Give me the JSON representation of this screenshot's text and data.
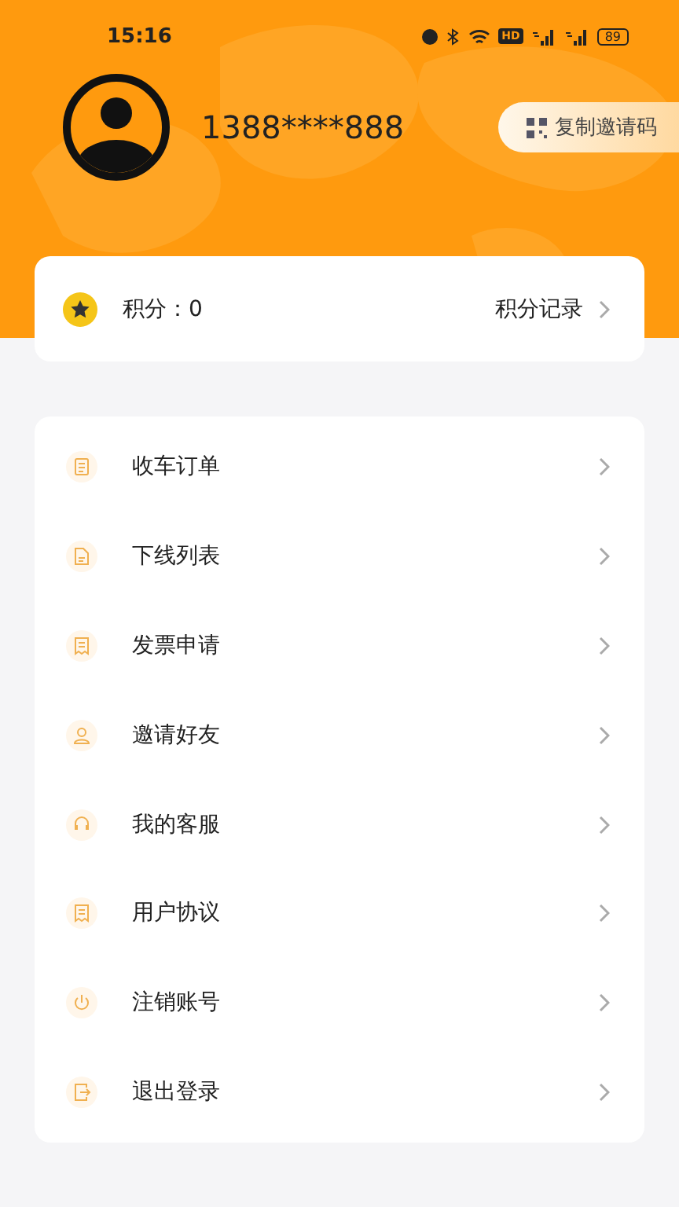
{
  "status_bar": {
    "time": "15:16",
    "hd_label": "HD",
    "battery": "89"
  },
  "profile": {
    "phone": "1388****888",
    "invite_button": "复制邀请码"
  },
  "points": {
    "label": "积分：0",
    "link": "积分记录"
  },
  "menu": [
    {
      "label": "收车订单",
      "kind": "doc"
    },
    {
      "label": "下线列表",
      "kind": "file"
    },
    {
      "label": "发票申请",
      "kind": "receipt"
    },
    {
      "label": "邀请好友",
      "kind": "person"
    },
    {
      "label": "我的客服",
      "kind": "headset"
    },
    {
      "label": "用户协议",
      "kind": "receipt"
    },
    {
      "label": "注销账号",
      "kind": "power"
    },
    {
      "label": "退出登录",
      "kind": "logout"
    }
  ]
}
